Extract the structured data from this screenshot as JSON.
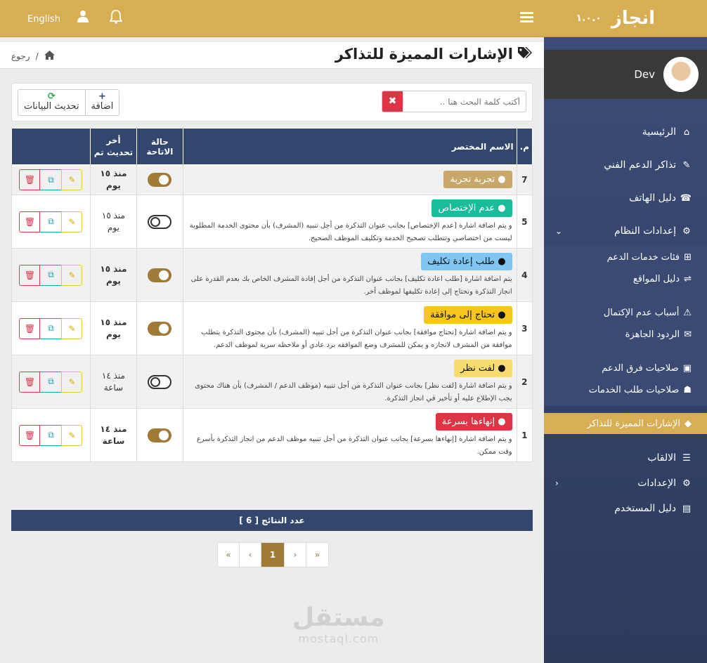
{
  "topbar": {
    "language": "English",
    "user_icon": "user-icon",
    "bell_icon": "bell-icon",
    "menu_icon": "hamburger-menu-icon"
  },
  "page": {
    "title": "الإشارات المميزة للتذاكر",
    "back": "رجوع",
    "home_icon": "home-icon",
    "tag_icon": "tags-icon"
  },
  "toolbar": {
    "add_label": "اضافة",
    "add_symbol": "+",
    "refresh_label": "تحديث البيانات",
    "refresh_symbol": "⟳"
  },
  "search": {
    "placeholder": "أكتب كلمة البحث هنا ..",
    "clear": "✖"
  },
  "table": {
    "headers": {
      "num": "م.",
      "name": "الاسم المختصر",
      "status": "حالة الاتاحة",
      "updated": "أخر تحديث تم"
    },
    "rows": [
      {
        "num": "7",
        "badge": "تجربة تجربة",
        "badge_icon": "tag-icon",
        "badge_bg": "#c9a76a",
        "badge_fg": "#ffffff",
        "desc": "",
        "enabled": true,
        "time1": "منذ ١٥",
        "time2": "يوم",
        "bold": true
      },
      {
        "num": "5",
        "badge": "عدم الإختصاص",
        "badge_icon": "ban-icon",
        "badge_bg": "#1abc9c",
        "badge_fg": "#ffffff",
        "desc": "و يتم اضافة اشارة [عدم الإختصاص] بجانب عنوان التذكرة من أجل تنبيه (المشرف) بأن محتوى الخدمة المطلوبة ليست من اختصاصي وتتطلب تصحيح الخدمة وتكليف الموظف الصحيح.",
        "enabled": false,
        "time1": "منذ ١٥",
        "time2": "يوم",
        "bold": false
      },
      {
        "num": "4",
        "badge": "طلب إعادة تكليف",
        "badge_icon": "reply-icon",
        "badge_bg": "#7fc7f2",
        "badge_fg": "#111111",
        "desc": "يتم اضافة اشارة [طلب اعادة تكليف] بجانب عنوان التذكرة من أجل إفادة المشرف الخاص بك بعدم القدرة على انجاز التذكرة وتحتاج إلى إعادة تكليفها لموظف أخر.",
        "enabled": true,
        "time1": "منذ ١٥",
        "time2": "يوم",
        "bold": true
      },
      {
        "num": "3",
        "badge": "تحتاج إلى موافقة",
        "badge_icon": "thumbs-up-icon",
        "badge_bg": "#f6c61f",
        "badge_fg": "#111111",
        "desc": "و يتم اضافة اشارة [تحتاج موافقة] بجانب عنوان التذكرة من أجل تنبيه (المشرف) بأن محتوى التذكرة يتطلب موافقة من المشرف لانجازه و يمكن للمشرف وضع الموافقه برد عادي أو ملاحظه سرية لموظف الدعم.",
        "enabled": true,
        "time1": "منذ ١٥",
        "time2": "يوم",
        "bold": true
      },
      {
        "num": "2",
        "badge": "لفت نظر",
        "badge_icon": "flag-icon",
        "badge_bg": "#f7dc6f",
        "badge_fg": "#111111",
        "desc": "و يتم اضافة اشارة [لفت نظر] بجانب عنوان التذكرة من أجل تنبيه (موظف الدعم / المشرف) بأن هناك محتوى يجب الإطلاع عليه أو تأخير في انجاز التذكرة.",
        "enabled": false,
        "time1": "منذ ١٤",
        "time2": "ساعة",
        "bold": false
      },
      {
        "num": "1",
        "badge": "إنهاءها بسرعة",
        "badge_icon": "asterisk-icon",
        "badge_bg": "#dc3545",
        "badge_fg": "#ffffff",
        "desc": "و يتم اضافة اشارة [إنهاءها بسرعة] بجانب عنوان التذكرة من أجل تنبيه موظف الدعم من انجاز التذكرة بأسرع وقت ممكن.",
        "enabled": true,
        "time1": "منذ ١٤",
        "time2": "ساعة",
        "bold": true
      }
    ],
    "footer": "عدد النتائج [ 6 ]"
  },
  "pager": {
    "first": "«",
    "prev": "‹",
    "current": "1",
    "next": "›",
    "last": "»"
  },
  "watermark": {
    "big": "مستقل",
    "small": "mostaql.com"
  },
  "sidebar": {
    "brand": "انجاز",
    "version": "١.٠.٠",
    "user": "Dev",
    "items": [
      {
        "label": "الرئيسية",
        "icon": "home-icon",
        "glyph": "⌂"
      },
      {
        "label": "تذاكر الدعم الفني",
        "icon": "ticket-icon",
        "glyph": "✎"
      },
      {
        "label": "دليل الهاتف",
        "icon": "address-book-icon",
        "glyph": "☎"
      },
      {
        "label": "إعدادات النظام",
        "icon": "cogs-icon",
        "glyph": "⚙"
      }
    ],
    "sub": [
      {
        "label": "فئات خدمات الدعم",
        "icon": "sitemap-icon",
        "glyph": "⊞"
      },
      {
        "label": "دليل المواقع",
        "icon": "map-signs-icon",
        "glyph": "⇌"
      },
      {
        "label": "أسباب عدم الإكتمال",
        "icon": "warning-icon",
        "glyph": "⚠"
      },
      {
        "label": "الردود الجاهزة",
        "icon": "comment-icon",
        "glyph": "✉"
      },
      {
        "label": "صلاحيات فرق الدعم",
        "icon": "id-badge-icon",
        "glyph": "▣"
      },
      {
        "label": "صلاحيات طلب الخدمات",
        "icon": "users-icon",
        "glyph": "☗"
      }
    ],
    "active": {
      "label": "الإشارات المميزة للتذاكر",
      "icon": "tag-icon",
      "glyph": "◆"
    },
    "lower": [
      {
        "label": "الالقاب",
        "icon": "sliders-icon",
        "glyph": "☰"
      },
      {
        "label": "الإعدادات",
        "icon": "cogs-icon",
        "glyph": "⚙"
      },
      {
        "label": "دليل المستخدم",
        "icon": "book-icon",
        "glyph": "▤"
      }
    ]
  }
}
